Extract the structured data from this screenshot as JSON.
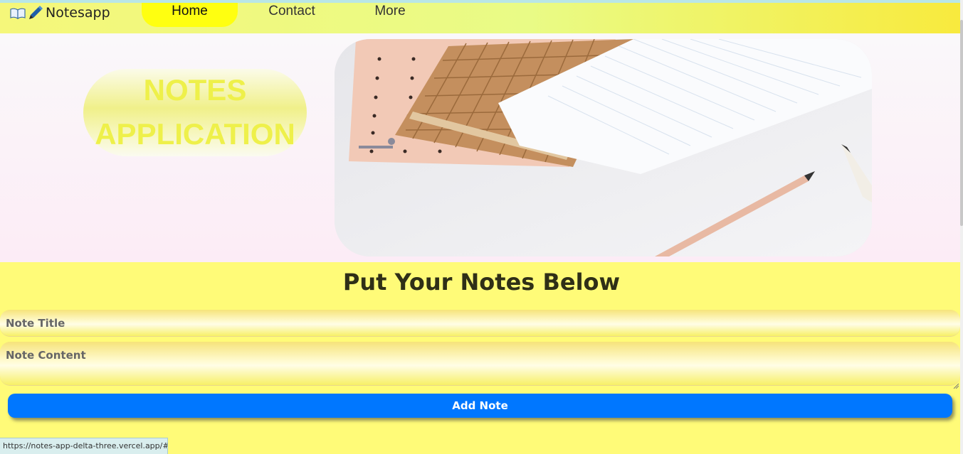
{
  "navbar": {
    "brand": "Notesapp",
    "brand_icons": [
      "open-book-icon",
      "pencil-icon"
    ],
    "links": [
      {
        "label": "Home",
        "active": true
      },
      {
        "label": "Contact",
        "active": false
      },
      {
        "label": "More",
        "active": false
      }
    ]
  },
  "hero": {
    "title_line1": "NOTES",
    "title_line2": "APPLICATION",
    "image": "notebooks-and-pencils-photo"
  },
  "form": {
    "heading": "Put Your Notes Below",
    "title_placeholder": "Note Title",
    "content_placeholder": "Note Content",
    "add_button": "Add Note"
  },
  "status_url": "https://notes-app-delta-three.vercel.app/#",
  "colors": {
    "accent_button": "#0077ff",
    "nav_active": "#ffff10",
    "page_bg": "#fffb78"
  }
}
